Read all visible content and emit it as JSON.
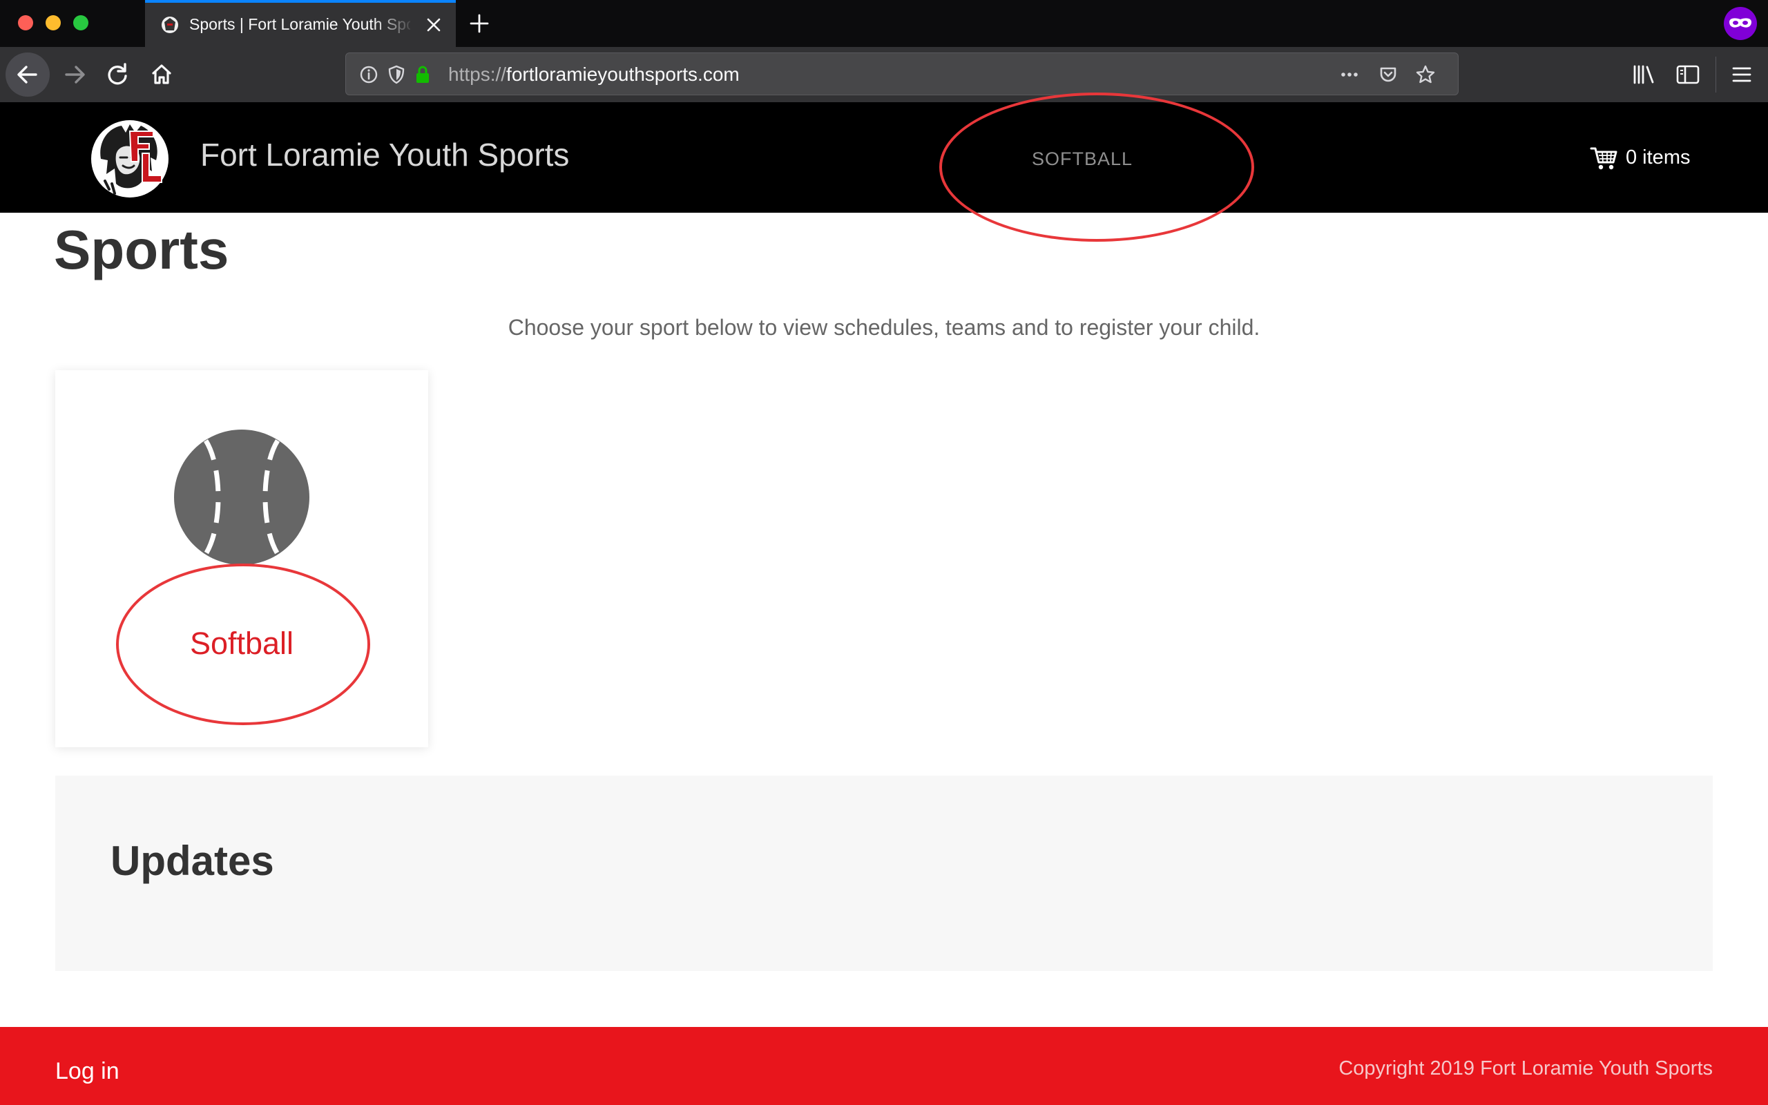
{
  "browser": {
    "tab_title": "Sports | Fort Loramie Youth Sports",
    "url_protocol": "https://",
    "url_host": "fortloramieyouthsports.com"
  },
  "site": {
    "name": "Fort Loramie Youth Sports",
    "menu": [
      {
        "label": "SOFTBALL"
      }
    ],
    "cart_label": "0 items"
  },
  "page": {
    "title": "Sports",
    "intro": "Choose your sport below to view schedules, teams and to register your child.",
    "sports": [
      {
        "name": "Softball",
        "icon": "softball-icon"
      }
    ],
    "updates_title": "Updates"
  },
  "footer": {
    "login_label": "Log in",
    "copyright": "Copyright 2019 Fort Loramie Youth Sports"
  },
  "colors": {
    "accent_red": "#e8151c",
    "link_red": "#dc1f26",
    "annotation_red": "#e8373a",
    "header_bg": "#000000",
    "update_bg": "#f7f7f7"
  }
}
